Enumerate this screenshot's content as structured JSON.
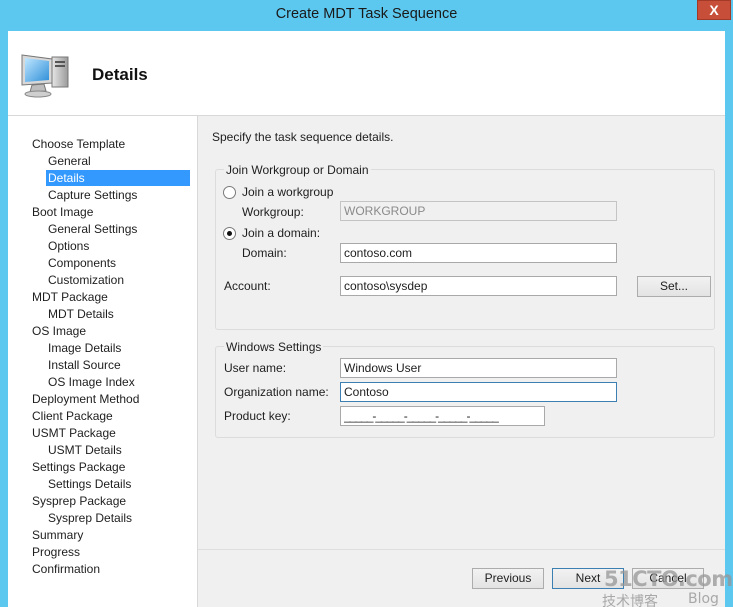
{
  "window": {
    "title": "Create MDT Task Sequence",
    "close_glyph": "X"
  },
  "header": {
    "title": "Details",
    "icon": "computer-icon"
  },
  "nav": {
    "items": [
      {
        "label": "Choose Template",
        "level": 0
      },
      {
        "label": "General",
        "level": 1
      },
      {
        "label": "Details",
        "level": 1,
        "selected": true
      },
      {
        "label": "Capture Settings",
        "level": 1
      },
      {
        "label": "Boot Image",
        "level": 0
      },
      {
        "label": "General Settings",
        "level": 1
      },
      {
        "label": "Options",
        "level": 1
      },
      {
        "label": "Components",
        "level": 1
      },
      {
        "label": "Customization",
        "level": 1
      },
      {
        "label": "MDT Package",
        "level": 0
      },
      {
        "label": "MDT Details",
        "level": 1
      },
      {
        "label": "OS Image",
        "level": 0
      },
      {
        "label": "Image Details",
        "level": 1
      },
      {
        "label": "Install Source",
        "level": 1
      },
      {
        "label": "OS Image Index",
        "level": 1
      },
      {
        "label": "Deployment Method",
        "level": 0
      },
      {
        "label": "Client Package",
        "level": 0
      },
      {
        "label": "USMT Package",
        "level": 0
      },
      {
        "label": "USMT Details",
        "level": 1
      },
      {
        "label": "Settings Package",
        "level": 0
      },
      {
        "label": "Settings Details",
        "level": 1
      },
      {
        "label": "Sysprep Package",
        "level": 0
      },
      {
        "label": "Sysprep Details",
        "level": 1
      },
      {
        "label": "Summary",
        "level": 0
      },
      {
        "label": "Progress",
        "level": 0
      },
      {
        "label": "Confirmation",
        "level": 0
      }
    ]
  },
  "main": {
    "description": "Specify the task sequence details.",
    "join_group": {
      "title": "Join Workgroup or Domain",
      "workgroup_radio": "Join a workgroup",
      "workgroup_label": "Workgroup:",
      "workgroup_value": "WORKGROUP",
      "domain_radio": "Join a domain:",
      "domain_label": "Domain:",
      "domain_value": "contoso.com",
      "account_label": "Account:",
      "account_value": "contoso\\sysdep",
      "set_button": "Set...",
      "selected": "domain"
    },
    "windows_settings": {
      "title": "Windows Settings",
      "user_name_label": "User name:",
      "user_name_value": "Windows User",
      "org_label": "Organization name:",
      "org_value": "Contoso",
      "product_key_label": "Product key:",
      "product_key_value": "_____-_____-_____-_____-_____"
    }
  },
  "footer": {
    "previous": "Previous",
    "next": "Next",
    "cancel": "Cancel"
  },
  "watermark": {
    "site": "51CTO.com",
    "blog": "技术博客",
    "blog_en": "Blog"
  },
  "colors": {
    "titlebar": "#5cc8f0",
    "selection": "#3399ff",
    "close": "#c74f3a"
  }
}
